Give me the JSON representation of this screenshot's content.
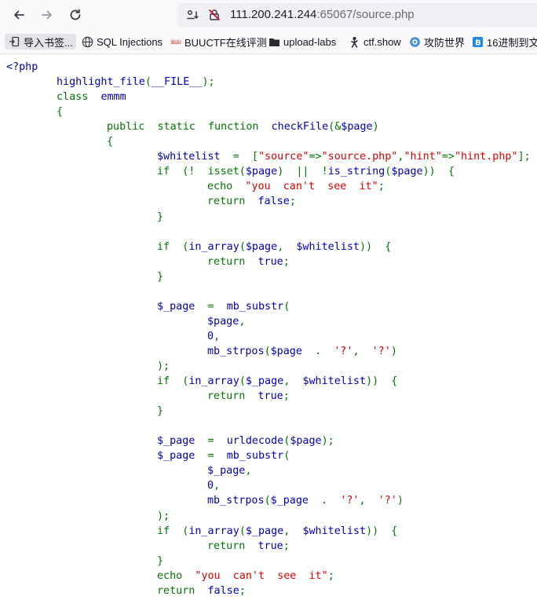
{
  "browser": {
    "url_host": "111.200.241.244",
    "url_rest": ":65067/source.php"
  },
  "bookmarks": [
    {
      "label": "导入书签...",
      "icon": "import-icon"
    },
    {
      "label": "SQL Injections",
      "icon": "globe-icon"
    },
    {
      "label": "BUUCTF在线评测",
      "icon": "buuctf-icon"
    },
    {
      "label": "upload-labs",
      "icon": "folder-icon"
    },
    {
      "label": "ctf.show",
      "icon": "ctfshow-icon"
    },
    {
      "label": "攻防世界",
      "icon": "adworld-icon"
    },
    {
      "label": "16进制到文",
      "icon": "hex-icon"
    }
  ],
  "code_lines": [
    {
      "indent": 0,
      "tokens": [
        {
          "t": "<?php",
          "c": "d"
        }
      ]
    },
    {
      "indent": 1,
      "tokens": [
        {
          "t": "highlight_file",
          "c": "d"
        },
        {
          "t": "(",
          "c": "k"
        },
        {
          "t": "__FILE__",
          "c": "d"
        },
        {
          "t": ");",
          "c": "k"
        }
      ]
    },
    {
      "indent": 1,
      "tokens": [
        {
          "t": "class  ",
          "c": "k"
        },
        {
          "t": "emmm",
          "c": "d"
        }
      ]
    },
    {
      "indent": 1,
      "tokens": [
        {
          "t": "{",
          "c": "k"
        }
      ]
    },
    {
      "indent": 2,
      "tokens": [
        {
          "t": "public  static  function  ",
          "c": "k"
        },
        {
          "t": "checkFile",
          "c": "d"
        },
        {
          "t": "(&",
          "c": "k"
        },
        {
          "t": "$page",
          "c": "d"
        },
        {
          "t": ")",
          "c": "k"
        }
      ]
    },
    {
      "indent": 2,
      "tokens": [
        {
          "t": "{",
          "c": "k"
        }
      ]
    },
    {
      "indent": 3,
      "tokens": [
        {
          "t": "$whitelist  ",
          "c": "d"
        },
        {
          "t": "=  [",
          "c": "k"
        },
        {
          "t": "\"source\"",
          "c": "s"
        },
        {
          "t": "=>",
          "c": "k"
        },
        {
          "t": "\"source.php\"",
          "c": "s"
        },
        {
          "t": ",",
          "c": "k"
        },
        {
          "t": "\"hint\"",
          "c": "s"
        },
        {
          "t": "=>",
          "c": "k"
        },
        {
          "t": "\"hint.php\"",
          "c": "s"
        },
        {
          "t": "];",
          "c": "k"
        }
      ]
    },
    {
      "indent": 3,
      "tokens": [
        {
          "t": "if  (!  isset(",
          "c": "k"
        },
        {
          "t": "$page",
          "c": "d"
        },
        {
          "t": ")  ||  !",
          "c": "k"
        },
        {
          "t": "is_string",
          "c": "d"
        },
        {
          "t": "(",
          "c": "k"
        },
        {
          "t": "$page",
          "c": "d"
        },
        {
          "t": "))  {",
          "c": "k"
        }
      ]
    },
    {
      "indent": 4,
      "tokens": [
        {
          "t": "echo  ",
          "c": "k"
        },
        {
          "t": "\"you  can't  see  it\"",
          "c": "s"
        },
        {
          "t": ";",
          "c": "k"
        }
      ]
    },
    {
      "indent": 4,
      "tokens": [
        {
          "t": "return  ",
          "c": "k"
        },
        {
          "t": "false",
          "c": "d"
        },
        {
          "t": ";",
          "c": "k"
        }
      ]
    },
    {
      "indent": 3,
      "tokens": [
        {
          "t": "}",
          "c": "k"
        }
      ]
    },
    {
      "indent": 0,
      "tokens": []
    },
    {
      "indent": 3,
      "tokens": [
        {
          "t": "if  (",
          "c": "k"
        },
        {
          "t": "in_array",
          "c": "d"
        },
        {
          "t": "(",
          "c": "k"
        },
        {
          "t": "$page",
          "c": "d"
        },
        {
          "t": ",  ",
          "c": "k"
        },
        {
          "t": "$whitelist",
          "c": "d"
        },
        {
          "t": "))  {",
          "c": "k"
        }
      ]
    },
    {
      "indent": 4,
      "tokens": [
        {
          "t": "return  ",
          "c": "k"
        },
        {
          "t": "true",
          "c": "d"
        },
        {
          "t": ";",
          "c": "k"
        }
      ]
    },
    {
      "indent": 3,
      "tokens": [
        {
          "t": "}",
          "c": "k"
        }
      ]
    },
    {
      "indent": 0,
      "tokens": []
    },
    {
      "indent": 3,
      "tokens": [
        {
          "t": "$_page  ",
          "c": "d"
        },
        {
          "t": "=  ",
          "c": "k"
        },
        {
          "t": "mb_substr",
          "c": "d"
        },
        {
          "t": "(",
          "c": "k"
        }
      ]
    },
    {
      "indent": 4,
      "tokens": [
        {
          "t": "$page",
          "c": "d"
        },
        {
          "t": ",",
          "c": "k"
        }
      ]
    },
    {
      "indent": 4,
      "tokens": [
        {
          "t": "0",
          "c": "d"
        },
        {
          "t": ",",
          "c": "k"
        }
      ]
    },
    {
      "indent": 4,
      "tokens": [
        {
          "t": "mb_strpos",
          "c": "d"
        },
        {
          "t": "(",
          "c": "k"
        },
        {
          "t": "$page  ",
          "c": "d"
        },
        {
          "t": ".  ",
          "c": "k"
        },
        {
          "t": "'?'",
          "c": "s"
        },
        {
          "t": ",  ",
          "c": "k"
        },
        {
          "t": "'?'",
          "c": "s"
        },
        {
          "t": ")",
          "c": "k"
        }
      ]
    },
    {
      "indent": 3,
      "tokens": [
        {
          "t": ");",
          "c": "k"
        }
      ]
    },
    {
      "indent": 3,
      "tokens": [
        {
          "t": "if  (",
          "c": "k"
        },
        {
          "t": "in_array",
          "c": "d"
        },
        {
          "t": "(",
          "c": "k"
        },
        {
          "t": "$_page",
          "c": "d"
        },
        {
          "t": ",  ",
          "c": "k"
        },
        {
          "t": "$whitelist",
          "c": "d"
        },
        {
          "t": "))  {",
          "c": "k"
        }
      ]
    },
    {
      "indent": 4,
      "tokens": [
        {
          "t": "return  ",
          "c": "k"
        },
        {
          "t": "true",
          "c": "d"
        },
        {
          "t": ";",
          "c": "k"
        }
      ]
    },
    {
      "indent": 3,
      "tokens": [
        {
          "t": "}",
          "c": "k"
        }
      ]
    },
    {
      "indent": 0,
      "tokens": []
    },
    {
      "indent": 3,
      "tokens": [
        {
          "t": "$_page  ",
          "c": "d"
        },
        {
          "t": "=  ",
          "c": "k"
        },
        {
          "t": "urldecode",
          "c": "d"
        },
        {
          "t": "(",
          "c": "k"
        },
        {
          "t": "$page",
          "c": "d"
        },
        {
          "t": ");",
          "c": "k"
        }
      ]
    },
    {
      "indent": 3,
      "tokens": [
        {
          "t": "$_page  ",
          "c": "d"
        },
        {
          "t": "=  ",
          "c": "k"
        },
        {
          "t": "mb_substr",
          "c": "d"
        },
        {
          "t": "(",
          "c": "k"
        }
      ]
    },
    {
      "indent": 4,
      "tokens": [
        {
          "t": "$_page",
          "c": "d"
        },
        {
          "t": ",",
          "c": "k"
        }
      ]
    },
    {
      "indent": 4,
      "tokens": [
        {
          "t": "0",
          "c": "d"
        },
        {
          "t": ",",
          "c": "k"
        }
      ]
    },
    {
      "indent": 4,
      "tokens": [
        {
          "t": "mb_strpos",
          "c": "d"
        },
        {
          "t": "(",
          "c": "k"
        },
        {
          "t": "$_page  ",
          "c": "d"
        },
        {
          "t": ".  ",
          "c": "k"
        },
        {
          "t": "'?'",
          "c": "s"
        },
        {
          "t": ",  ",
          "c": "k"
        },
        {
          "t": "'?'",
          "c": "s"
        },
        {
          "t": ")",
          "c": "k"
        }
      ]
    },
    {
      "indent": 3,
      "tokens": [
        {
          "t": ");",
          "c": "k"
        }
      ]
    },
    {
      "indent": 3,
      "tokens": [
        {
          "t": "if  (",
          "c": "k"
        },
        {
          "t": "in_array",
          "c": "d"
        },
        {
          "t": "(",
          "c": "k"
        },
        {
          "t": "$_page",
          "c": "d"
        },
        {
          "t": ",  ",
          "c": "k"
        },
        {
          "t": "$whitelist",
          "c": "d"
        },
        {
          "t": "))  {",
          "c": "k"
        }
      ]
    },
    {
      "indent": 4,
      "tokens": [
        {
          "t": "return  ",
          "c": "k"
        },
        {
          "t": "true",
          "c": "d"
        },
        {
          "t": ";",
          "c": "k"
        }
      ]
    },
    {
      "indent": 3,
      "tokens": [
        {
          "t": "}",
          "c": "k"
        }
      ]
    },
    {
      "indent": 3,
      "tokens": [
        {
          "t": "echo  ",
          "c": "k"
        },
        {
          "t": "\"you  can't  see  it\"",
          "c": "s"
        },
        {
          "t": ";",
          "c": "k"
        }
      ]
    },
    {
      "indent": 3,
      "tokens": [
        {
          "t": "return  ",
          "c": "k"
        },
        {
          "t": "false",
          "c": "d"
        },
        {
          "t": ";",
          "c": "k"
        }
      ]
    },
    {
      "indent": 2,
      "tokens": [
        {
          "t": "}",
          "c": "k"
        }
      ]
    }
  ]
}
